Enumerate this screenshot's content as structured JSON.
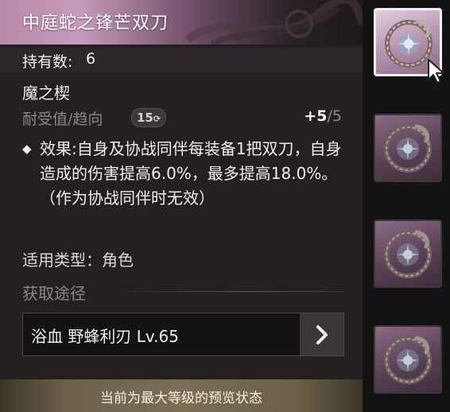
{
  "tooltip": {
    "title": "中庭蛇之锋芒双刀",
    "count_label": "持有数:",
    "count_value": "6",
    "subtitle": "魔之楔",
    "stat_label": "耐受值/趋向",
    "stat_badge": "15",
    "stat_value_current": "+5",
    "stat_value_max": "/5",
    "effect_text": "效果:自身及协战同伴每装备1把双刀，自身造成的伤害提高6.0%，最多提高18.0%。（作为协战同伴时无效）",
    "type_label": "适用类型：角色",
    "obtain_label": "获取途径",
    "source_text": "浴血 野蜂利刃 Lv.65",
    "footer_text": "当前为最大等级的预览状态"
  },
  "icons": {
    "item": "ouroboros-sigil-icon",
    "arrow": "chevron-right-icon",
    "bullet": "diamond-bullet-icon",
    "cursor": "mouse-cursor-icon"
  },
  "slots": [
    {
      "selected": true
    },
    {
      "selected": false
    },
    {
      "selected": false
    },
    {
      "selected": false
    }
  ],
  "colors": {
    "header_accent": "#c79bbb",
    "slot_bg": "#5a4156",
    "footer_bar": "#7a6e55"
  }
}
